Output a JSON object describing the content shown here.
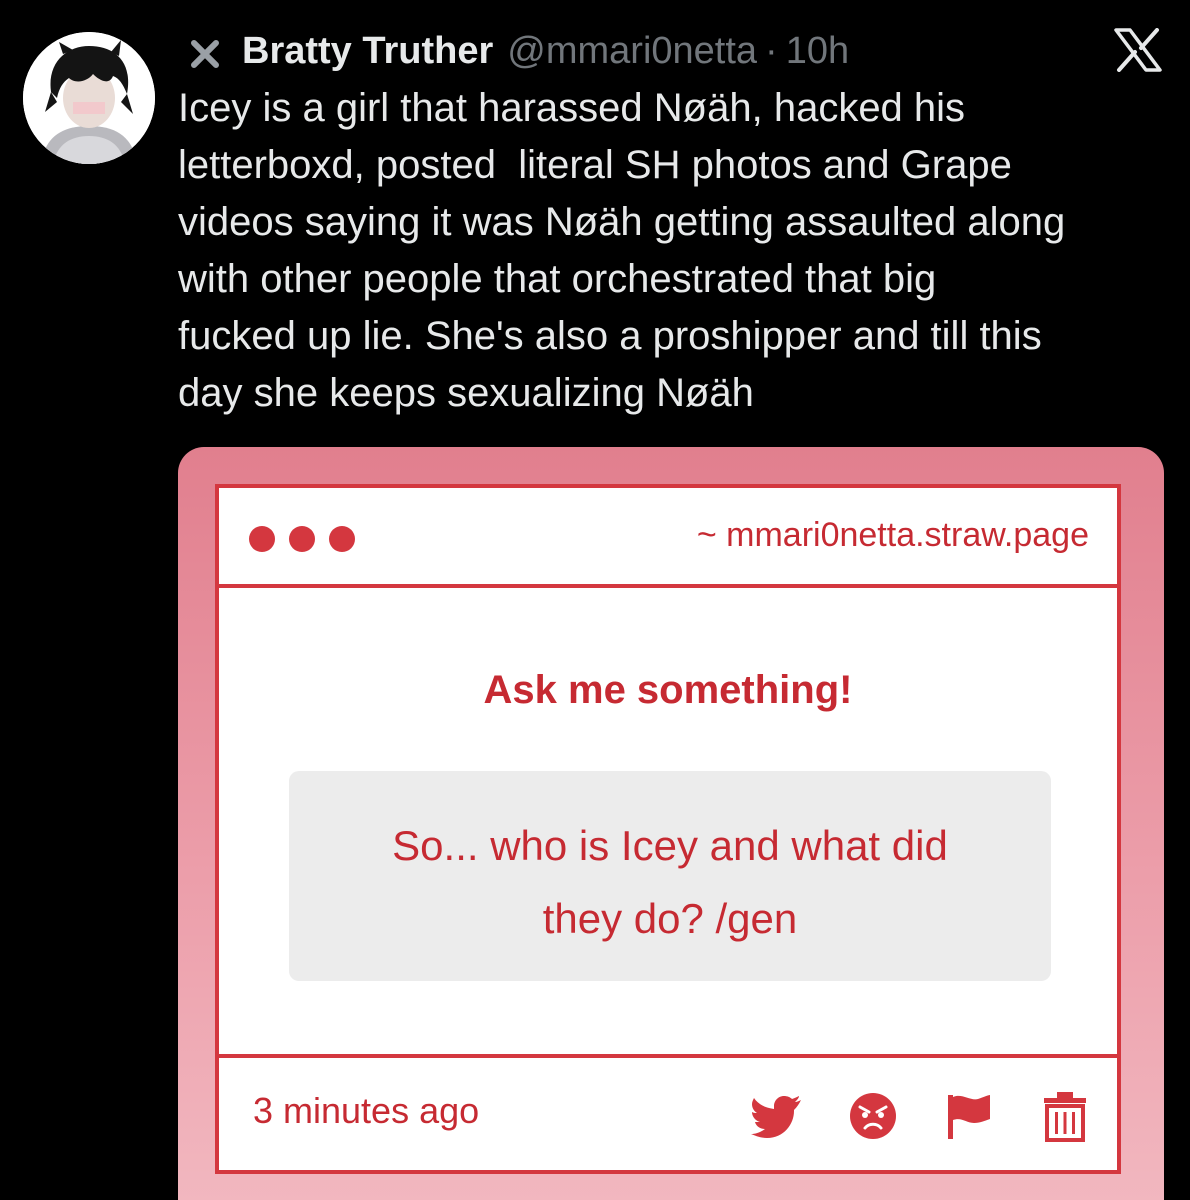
{
  "tweet": {
    "display_name": "Bratty Truther",
    "handle": "@mmari0netta",
    "separator": "·",
    "time": "10h",
    "text_lines": [
      "Icey is a girl that harassed Nøäh, hacked his",
      "letterboxd, posted  literal SH photos and Grape",
      "videos saying it was Nøäh getting assaulted along",
      "with other people that orchestrated that big",
      "fucked up lie. She's also a proshipper and till this",
      "day she keeps sexualizing Nøäh"
    ],
    "icons": {
      "name_prefix": "x-mark-icon",
      "platform_logo": "x-logo-icon",
      "avatar": "profile-avatar"
    }
  },
  "card": {
    "url": "~ mmari0netta.straw.page",
    "title": "Ask me something!",
    "question_lines": [
      "So... who is Icey and what did",
      "they do? /gen"
    ],
    "timestamp": "3 minutes ago",
    "footer_icons": [
      "twitter-bird-icon",
      "angry-face-icon",
      "flag-icon",
      "trash-icon"
    ],
    "colors": {
      "accent": "#d4373f",
      "text": "#c62a32",
      "frame": "#e17f8e",
      "question_bg": "#ececec"
    }
  }
}
